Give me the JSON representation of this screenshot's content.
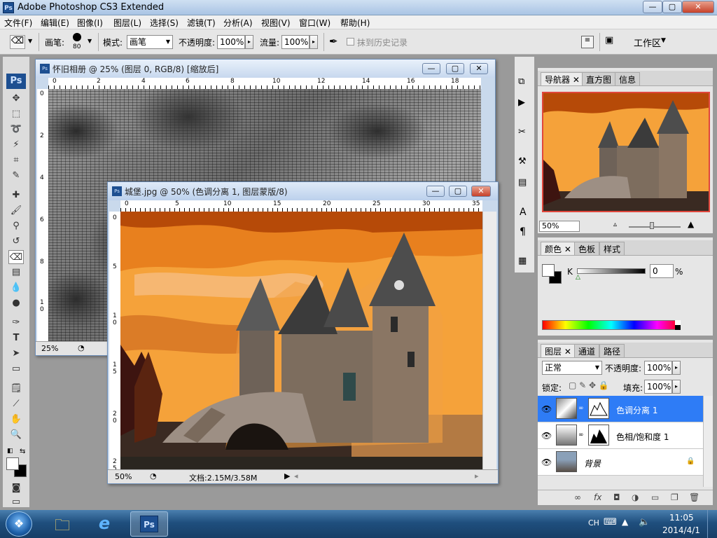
{
  "app": {
    "title": "Adobe Photoshop CS3 Extended",
    "icon": "Ps"
  },
  "window_controls": {
    "minimize": "—",
    "restore": "▢",
    "close": "✕"
  },
  "menu": [
    "文件(F)",
    "编辑(E)",
    "图像(I)",
    "图层(L)",
    "选择(S)",
    "滤镜(T)",
    "分析(A)",
    "视图(V)",
    "窗口(W)",
    "帮助(H)"
  ],
  "options": {
    "brush_label": "画笔:",
    "brush_size": "80",
    "mode_label": "模式:",
    "mode_value": "画笔",
    "opacity_label": "不透明度:",
    "opacity_value": "100%",
    "flow_label": "流量:",
    "flow_value": "100%",
    "erase_history": "抹到历史记录",
    "workspace": "工作区"
  },
  "doc1": {
    "title": "怀旧相册 @ 25% (图层 0, RGB/8) [缩放后]",
    "zoom": "25%",
    "ruler_h": [
      "0",
      "2",
      "4",
      "6",
      "8",
      "10",
      "12",
      "14",
      "16",
      "18"
    ],
    "ruler_v": [
      "0",
      "2",
      "4",
      "6",
      "8",
      "1 0"
    ]
  },
  "doc2": {
    "title": "城堡.jpg @ 50% (色调分离 1, 图层蒙版/8)",
    "zoom": "50%",
    "doc_info": "文档:2.15M/3.58M",
    "ruler_h": [
      "0",
      "5",
      "10",
      "15",
      "20",
      "25",
      "30",
      "35"
    ],
    "ruler_v": [
      "0",
      "5",
      "1 0",
      "1 5",
      "2 0",
      "2 5"
    ]
  },
  "navigator": {
    "tabs": [
      "导航器",
      "直方图",
      "信息"
    ],
    "zoom": "50%"
  },
  "color": {
    "tabs": [
      "颜色",
      "色板",
      "样式"
    ],
    "channel": "K",
    "value": "0",
    "unit": "%"
  },
  "layers_panel": {
    "tabs": [
      "图层",
      "通道",
      "路径"
    ],
    "blend_mode": "正常",
    "opacity_label": "不透明度:",
    "opacity_value": "100%",
    "lock_label": "锁定:",
    "fill_label": "填充:",
    "fill_value": "100%",
    "layers": [
      {
        "name": "色调分离 1",
        "selected": true
      },
      {
        "name": "色相/饱和度 1",
        "selected": false
      },
      {
        "name": "背景",
        "selected": false
      }
    ]
  },
  "taskbar": {
    "lang": "CH",
    "time": "11:05",
    "date": "2014/4/1"
  },
  "colors": {
    "accent": "#2e7cf6",
    "sky_orange": "#f5a53a",
    "dark_orange": "#b84a08"
  }
}
